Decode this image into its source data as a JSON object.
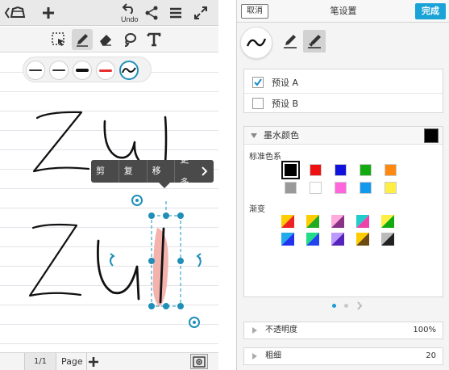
{
  "left": {
    "topbar": {
      "undo_label": "Undo"
    },
    "context_menu": {
      "items": [
        "剪切",
        "复制",
        "移除",
        "更多"
      ]
    },
    "pen_presets": [
      {
        "color": "#333333",
        "weight": 1
      },
      {
        "color": "#333333",
        "weight": 1
      },
      {
        "color": "#111111",
        "weight": 3
      },
      {
        "color": "#e53030",
        "weight": 2
      },
      {
        "color": "#111111",
        "weight": 2,
        "selected": true
      }
    ],
    "bottombar": {
      "page_number": "1/1",
      "page_label": "Page"
    }
  },
  "right": {
    "header": {
      "cancel": "取消",
      "title": "笔设置",
      "done": "完成"
    },
    "presets": [
      {
        "label": "预设 A",
        "checked": true
      },
      {
        "label": "预设 B",
        "checked": false
      }
    ],
    "ink_color": {
      "title": "墨水颜色",
      "current": "#000000",
      "standard_label": "标准色系",
      "standard": [
        "#000000",
        "#ee1111",
        "#1111dd",
        "#11aa11",
        "#ff8811",
        "#999999",
        "#ffffff",
        "#ff66dd",
        "#1199ee",
        "#ffee44"
      ],
      "gradient_label": "渐变"
    },
    "opacity": {
      "label": "不透明度",
      "value": "100%"
    },
    "thickness": {
      "label": "粗细",
      "value": "20"
    }
  }
}
